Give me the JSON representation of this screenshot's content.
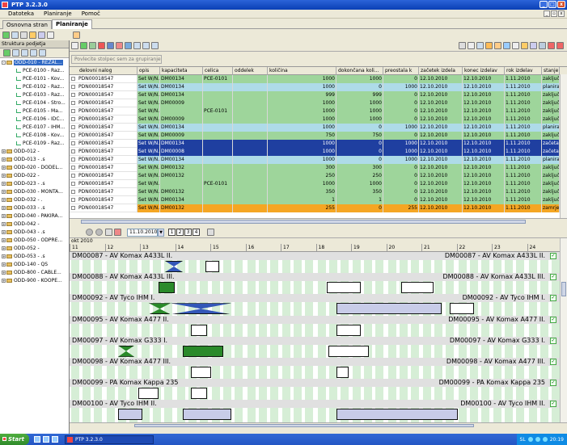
{
  "window": {
    "title": "PTP 3.2.3.0"
  },
  "menu": [
    "Datoteka",
    "Planiranje",
    "Pomoč"
  ],
  "tabs": [
    "Osnovna stran",
    "Planiranje"
  ],
  "left_panel": {
    "header": "Struktura podjetja",
    "tree": [
      {
        "label": "ODD-010 - REZAL...",
        "level": 0,
        "kind": "folder",
        "selected": true
      },
      {
        "label": "PCE-0100 - Raz...",
        "level": 1,
        "kind": "leaf"
      },
      {
        "label": "PCE-0101 - Kov...",
        "level": 1,
        "kind": "leaf"
      },
      {
        "label": "PCE-0102 - Raz...",
        "level": 1,
        "kind": "leaf"
      },
      {
        "label": "PCE-0103 - Raz...",
        "level": 1,
        "kind": "leaf"
      },
      {
        "label": "PCE-0104 - Stro...",
        "level": 1,
        "kind": "leaf"
      },
      {
        "label": "PCE-0105 - Ma...",
        "level": 1,
        "kind": "leaf"
      },
      {
        "label": "PCE-0106 - IDC...",
        "level": 1,
        "kind": "leaf"
      },
      {
        "label": "PCE-0107 - IHM...",
        "level": 1,
        "kind": "leaf"
      },
      {
        "label": "PCE-0108 - Kov...",
        "level": 1,
        "kind": "leaf"
      },
      {
        "label": "PCE-0109 - Raz...",
        "level": 1,
        "kind": "leaf"
      },
      {
        "label": "ODD-012 - ",
        "level": 0,
        "kind": "folder"
      },
      {
        "label": "ODD-013 - .s",
        "level": 0,
        "kind": "folder"
      },
      {
        "label": "ODD-020 - DODEL...",
        "level": 0,
        "kind": "folder"
      },
      {
        "label": "ODD-022 - ",
        "level": 0,
        "kind": "folder"
      },
      {
        "label": "ODD-023 - .s",
        "level": 0,
        "kind": "folder"
      },
      {
        "label": "ODD-030 - MONTA...",
        "level": 0,
        "kind": "folder"
      },
      {
        "label": "ODD-032 - .",
        "level": 0,
        "kind": "folder"
      },
      {
        "label": "ODD-033 - .s",
        "level": 0,
        "kind": "folder"
      },
      {
        "label": "ODD-040 - PAKIRA...",
        "level": 0,
        "kind": "folder"
      },
      {
        "label": "ODD-042 - ",
        "level": 0,
        "kind": "folder"
      },
      {
        "label": "ODD-043 - .s",
        "level": 0,
        "kind": "folder"
      },
      {
        "label": "ODD-050 - ODPRE...",
        "level": 0,
        "kind": "folder"
      },
      {
        "label": "ODD-052 - ",
        "level": 0,
        "kind": "folder"
      },
      {
        "label": "ODD-053 - .s",
        "level": 0,
        "kind": "folder"
      },
      {
        "label": "ODD-140 - QS",
        "level": 0,
        "kind": "folder"
      },
      {
        "label": "ODD-800 - CABLE...",
        "level": 0,
        "kind": "folder"
      },
      {
        "label": "ODD-900 - KOOPE...",
        "level": 0,
        "kind": "folder"
      }
    ]
  },
  "group_area": "Povlecite stolpec sem za grupiranje",
  "grid": {
    "columns": [
      "delovni nalog",
      "opis",
      "kapaciteta",
      "celica",
      "oddelek",
      "količina",
      "dokončana koli...",
      "preostala k",
      "začetek izdela",
      "konec izdelav",
      "rok izdelav",
      "stanje"
    ],
    "rows": [
      [
        "PDN00018547",
        "Set W/N...",
        "DM00134",
        "PCE-0101",
        "",
        "1000",
        "1000",
        "0",
        "12.10.2010",
        "12.10.2010",
        "1.11.2010",
        "zaključe",
        "green"
      ],
      [
        "PDN00018547",
        "Set W/N...",
        "DM00134",
        "",
        "",
        "1000",
        "0",
        "1000",
        "12.10.2010",
        "12.10.2010",
        "1.11.2010",
        "planiran",
        "blue"
      ],
      [
        "PDN00018547",
        "Set W/N...",
        "DM00134",
        "",
        "",
        "999",
        "999",
        "0",
        "12.10.2010",
        "12.10.2010",
        "1.11.2010",
        "zaključe",
        "green"
      ],
      [
        "PDN00018547",
        "Set W/N...",
        "DM00009",
        "",
        "",
        "1000",
        "1000",
        "0",
        "12.10.2010",
        "12.10.2010",
        "1.11.2010",
        "zaključe",
        "green"
      ],
      [
        "PDN00018547",
        "Set W/N...",
        "",
        "PCE-0101",
        "",
        "1000",
        "1000",
        "0",
        "12.10.2010",
        "12.10.2010",
        "1.11.2010",
        "zaključe",
        "green"
      ],
      [
        "PDN00018547",
        "Set W/N...",
        "DM00009",
        "",
        "",
        "1000",
        "1000",
        "0",
        "12.10.2010",
        "12.10.2010",
        "1.11.2010",
        "zaključe",
        "green"
      ],
      [
        "PDN00018547",
        "Set W/N...",
        "DM00134",
        "",
        "",
        "1000",
        "0",
        "1000",
        "12.10.2010",
        "12.10.2010",
        "1.11.2010",
        "planiran",
        "blue"
      ],
      [
        "PDN00018547",
        "Set W/N...",
        "DM00009",
        "",
        "",
        "750",
        "750",
        "0",
        "12.10.2010",
        "12.10.2010",
        "1.11.2010",
        "zaključe",
        "green"
      ],
      [
        "PDN00018547",
        "Set W/N...",
        "DM00134",
        "",
        "",
        "1000",
        "0",
        "1000",
        "12.10.2010",
        "12.10.2010",
        "1.11.2010",
        "začeta",
        "selected"
      ],
      [
        "PDN00018547",
        "Set W/N...",
        "DM00008",
        "",
        "",
        "1000",
        "0",
        "1000",
        "12.10.2010",
        "12.10.2010",
        "1.11.2010",
        "začeta",
        "selected"
      ],
      [
        "PDN00018547",
        "Set W/N...",
        "DM00134",
        "",
        "",
        "1000",
        "0",
        "1000",
        "12.10.2010",
        "12.10.2010",
        "1.11.2010",
        "planiran",
        "blue"
      ],
      [
        "PDN00018547",
        "Set W/N...",
        "DM00132",
        "",
        "",
        "300",
        "300",
        "0",
        "12.10.2010",
        "12.10.2010",
        "1.11.2010",
        "zaključe",
        "green"
      ],
      [
        "PDN00018547",
        "Set W/N...",
        "DM00132",
        "",
        "",
        "250",
        "250",
        "0",
        "12.10.2010",
        "12.10.2010",
        "1.11.2010",
        "zaključe",
        "green"
      ],
      [
        "PDN00018547",
        "Set W/N...",
        "",
        "PCE-0101",
        "",
        "1000",
        "1000",
        "0",
        "12.10.2010",
        "12.10.2010",
        "1.11.2010",
        "zaključe",
        "green"
      ],
      [
        "PDN00018547",
        "Set W/N...",
        "DM00132",
        "",
        "",
        "350",
        "350",
        "0",
        "12.10.2010",
        "12.10.2010",
        "1.11.2010",
        "zaključe",
        "green"
      ],
      [
        "PDN00018547",
        "Set W/N...",
        "DM00134",
        "",
        "",
        "1",
        "1",
        "0",
        "12.10.2010",
        "12.10.2010",
        "1.11.2010",
        "zaključe",
        "green"
      ],
      [
        "PDN00018547",
        "Set W/N...",
        "DM00132",
        "",
        "",
        "255",
        "0",
        "255",
        "12.10.2010",
        "12.10.2010",
        "1.11.2010",
        "zamrjen",
        "orange"
      ]
    ]
  },
  "gantt_toolbar": {
    "date": "11.10.2010",
    "buttons": [
      "1",
      "2",
      "3",
      "4"
    ]
  },
  "gantt": {
    "month": "okt 2010",
    "days": [
      "11",
      "12",
      "13",
      "14",
      "15",
      "16",
      "17",
      "18",
      "19",
      "20",
      "21",
      "22",
      "23",
      "24"
    ],
    "rows": [
      {
        "left": "DM00087 - AV Komax A433L II.",
        "right": "DM00087 - AV Komax A433L II."
      },
      {
        "left": "DM00088 - AV Komax A433L III.",
        "right": "DM00088 - AV Komax A433L III."
      },
      {
        "left": "DM00092 - AV Tyco IHM I.",
        "right": "DM00092 - AV Tyco IHM I."
      },
      {
        "left": "DM00095 - AV Komax A477 II.",
        "right": "DM00095 - AV Komax A477 II."
      },
      {
        "left": "DM00097 - AV Komax G333 I.",
        "right": "DM00097 - AV Komax G333 I."
      },
      {
        "left": "DM00098 - AV Komax A477 III.",
        "right": "DM00098 - AV Komax A477 III."
      },
      {
        "left": "DM00099 - PA Komax Kappa 235",
        "right": "DM00099 - PA Komax Kappa 235"
      },
      {
        "left": "DM00100 - AV Tyco IHM II.",
        "right": "DM00100 - AV Tyco IHM II."
      }
    ]
  },
  "taskbar": {
    "start": "Start",
    "task": "PTP 3.2.3.0",
    "lang": "SL",
    "clock": "20:19"
  },
  "colors": {
    "green": "#9ed59b",
    "blue": "#aedbe8",
    "selected": "#1f3fa0",
    "orange": "#f5a623",
    "title": "#0a3fb5"
  }
}
